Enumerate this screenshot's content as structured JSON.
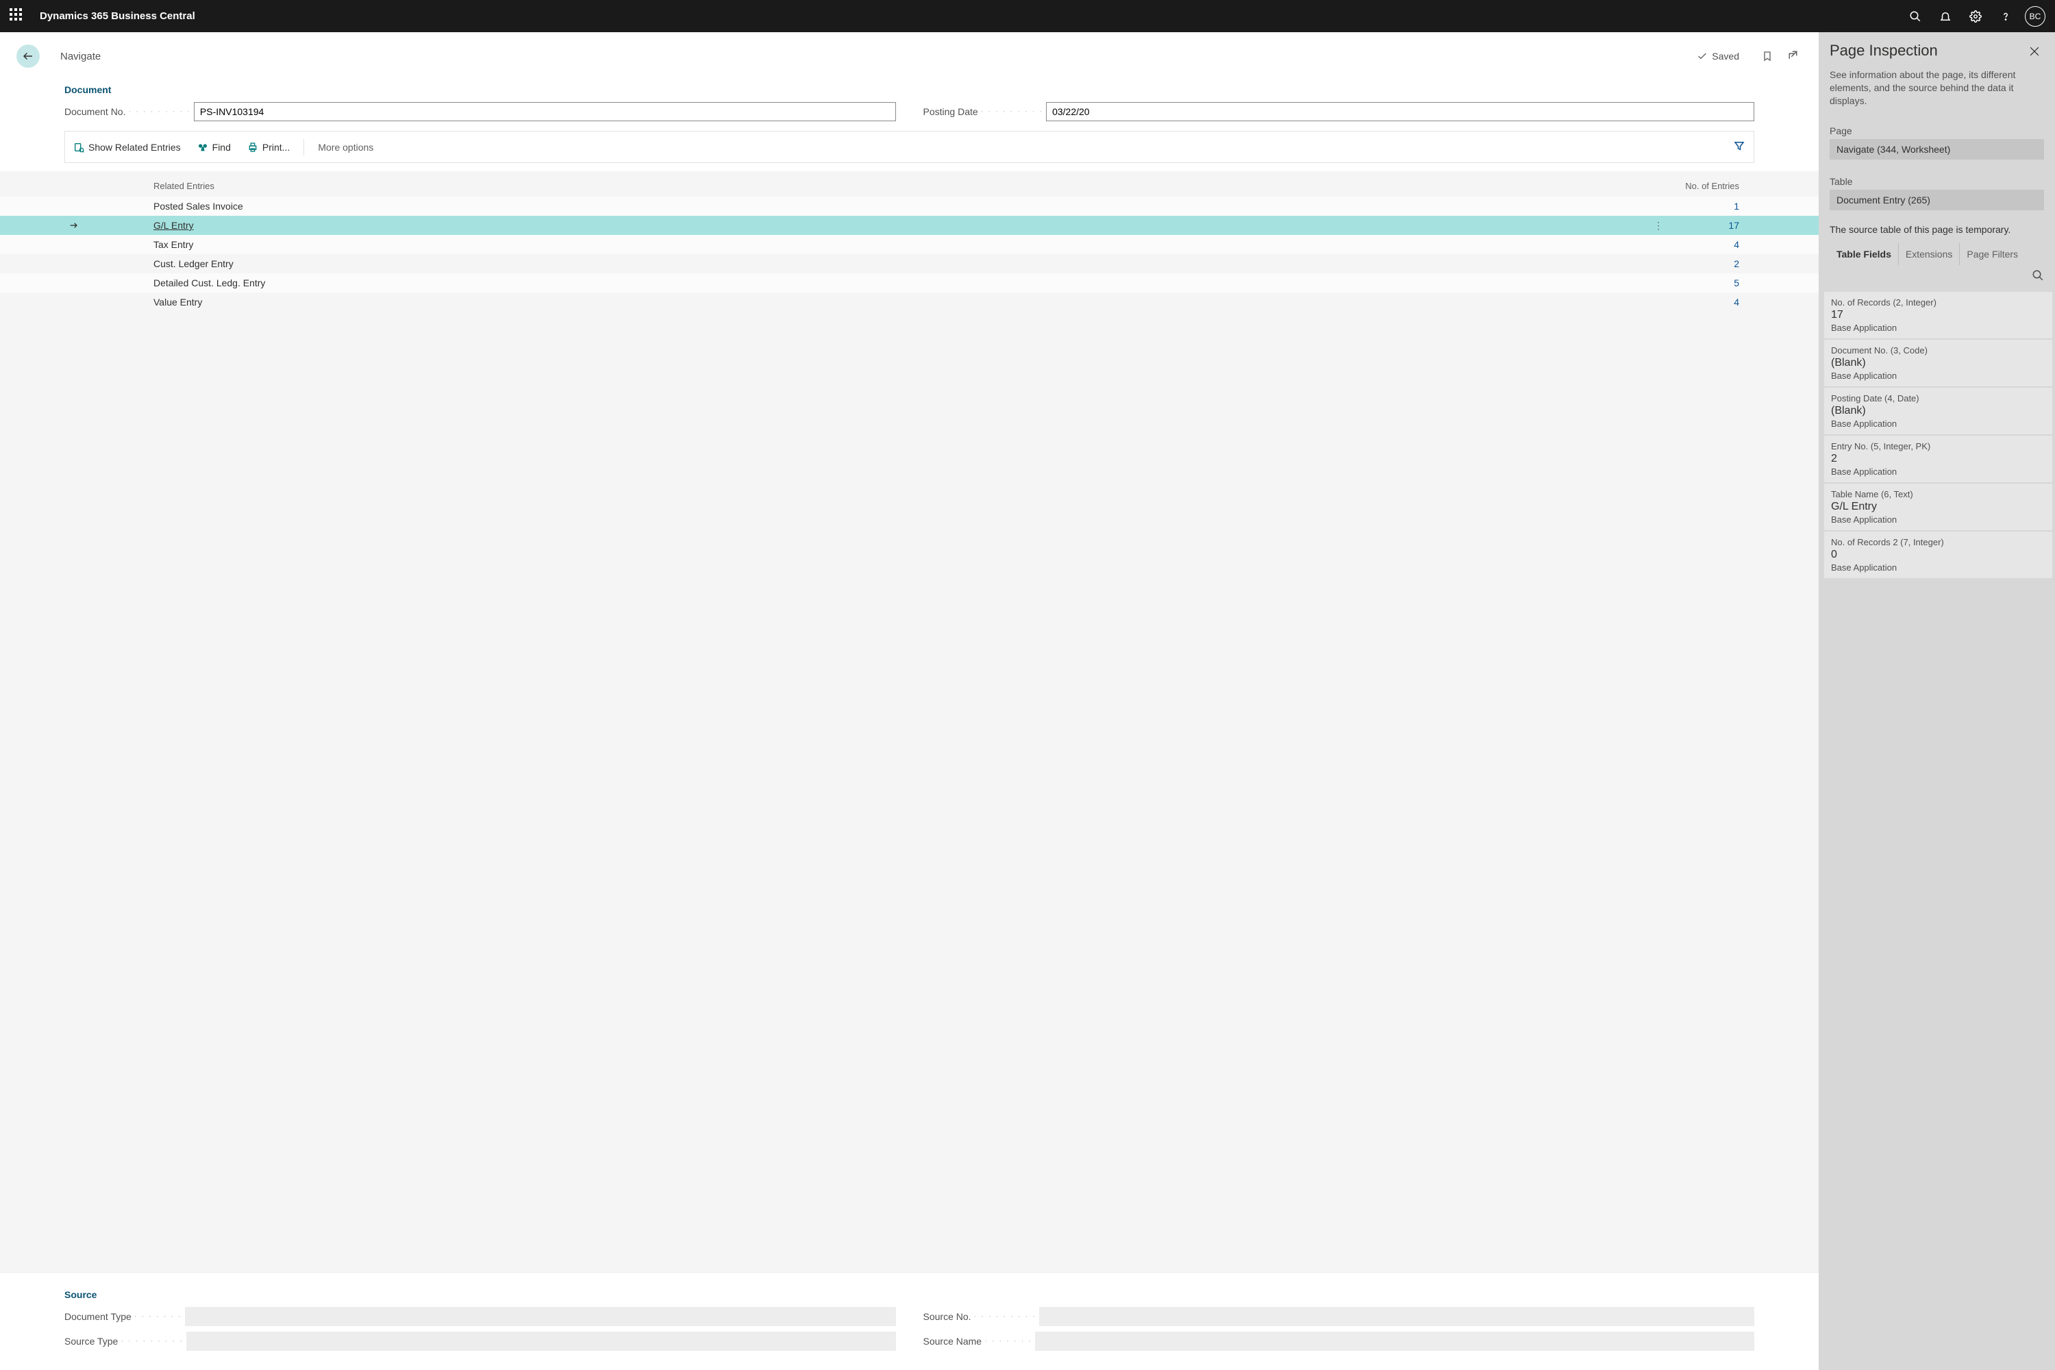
{
  "topbar": {
    "app_title": "Dynamics 365 Business Central",
    "avatar_initials": "BC"
  },
  "page": {
    "title": "Navigate",
    "saved_label": "Saved"
  },
  "document": {
    "section_title": "Document",
    "doc_no_label": "Document No.",
    "doc_no_value": "PS-INV103194",
    "posting_date_label": "Posting Date",
    "posting_date_value": "03/22/20"
  },
  "toolbar": {
    "show_related": "Show Related Entries",
    "find": "Find",
    "print": "Print...",
    "more": "More options"
  },
  "table": {
    "col_name": "Related Entries",
    "col_count": "No. of Entries",
    "rows": [
      {
        "name": "Posted Sales Invoice",
        "count": "1",
        "selected": false
      },
      {
        "name": "G/L Entry",
        "count": "17",
        "selected": true
      },
      {
        "name": "Tax Entry",
        "count": "4",
        "selected": false
      },
      {
        "name": "Cust. Ledger Entry",
        "count": "2",
        "selected": false
      },
      {
        "name": "Detailed Cust. Ledg. Entry",
        "count": "5",
        "selected": false
      },
      {
        "name": "Value Entry",
        "count": "4",
        "selected": false
      }
    ]
  },
  "source": {
    "section_title": "Source",
    "doc_type_label": "Document Type",
    "doc_type_value": "",
    "source_type_label": "Source Type",
    "source_type_value": "",
    "source_no_label": "Source No.",
    "source_no_value": "",
    "source_name_label": "Source Name",
    "source_name_value": ""
  },
  "inspector": {
    "title": "Page Inspection",
    "description": "See information about the page, its different elements, and the source behind the data it displays.",
    "page_label": "Page",
    "page_value": "Navigate (344, Worksheet)",
    "table_label": "Table",
    "table_value": "Document Entry (265)",
    "temp_note": "The source table of this page is temporary.",
    "tabs": {
      "fields": "Table Fields",
      "extensions": "Extensions",
      "filters": "Page Filters"
    },
    "fields": [
      {
        "name": "No. of Records (2, Integer)",
        "value": "17",
        "src": "Base Application"
      },
      {
        "name": "Document No. (3, Code)",
        "value": "(Blank)",
        "src": "Base Application"
      },
      {
        "name": "Posting Date (4, Date)",
        "value": "(Blank)",
        "src": "Base Application"
      },
      {
        "name": "Entry No. (5, Integer, PK)",
        "value": "2",
        "src": "Base Application"
      },
      {
        "name": "Table Name (6, Text)",
        "value": "G/L Entry",
        "src": "Base Application"
      },
      {
        "name": "No. of Records 2 (7, Integer)",
        "value": "0",
        "src": "Base Application"
      }
    ]
  }
}
